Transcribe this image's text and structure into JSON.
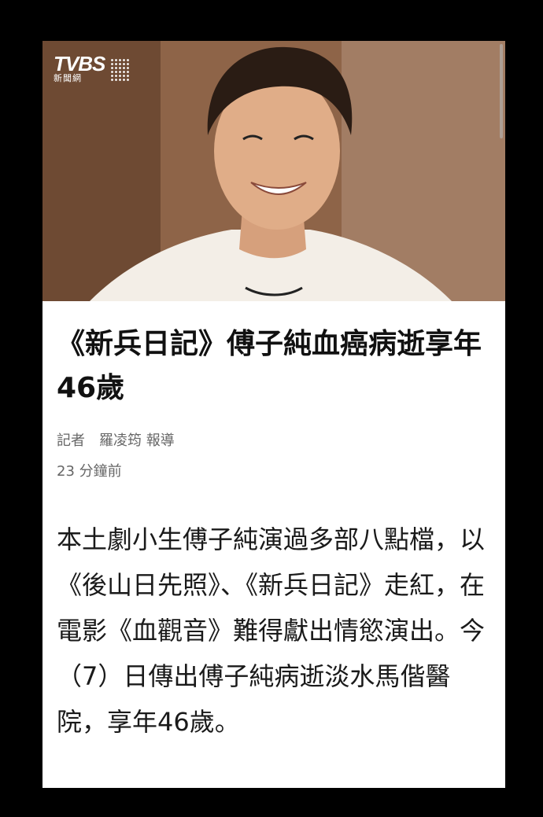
{
  "hero": {
    "logo_brand": "TVBS",
    "logo_sub": "新聞網"
  },
  "article": {
    "title": "《新兵日記》傅子純血癌病逝享年46歲",
    "byline": "記者　羅凌筠 報導",
    "time": "23 分鐘前",
    "body": "本土劇小生傅子純演過多部八點檔，以《後山日先照》、《新兵日記》走紅，在電影《血觀音》難得獻出情慾演出。今（7）日傳出傅子純病逝淡水馬偕醫院，享年46歲。"
  }
}
